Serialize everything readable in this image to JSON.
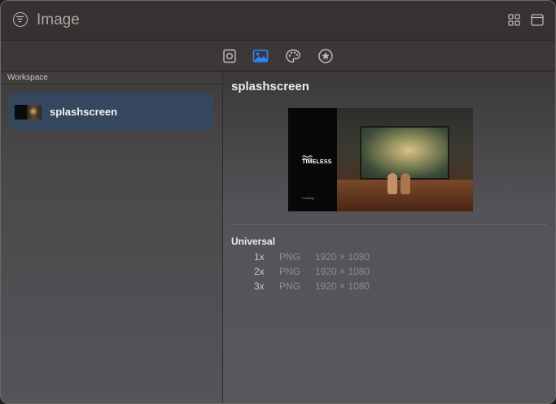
{
  "window": {
    "title": "Image"
  },
  "toolbar": {
    "tabs": [
      {
        "icon": "file-inspector-icon",
        "active": false
      },
      {
        "icon": "image-icon",
        "active": true
      },
      {
        "icon": "palette-icon",
        "active": false
      },
      {
        "icon": "star-icon",
        "active": false
      }
    ],
    "accent": "#2f86ff"
  },
  "sidebar": {
    "header": "Workspace",
    "items": [
      {
        "label": "splashscreen",
        "selected": true
      }
    ]
  },
  "detail": {
    "title": "splashscreen",
    "preview": {
      "logo_text": "TIMELESS",
      "loading_text": "Loading..."
    },
    "section_title": "Universal",
    "variants": [
      {
        "scale": "1x",
        "format": "PNG",
        "dimensions": "1920 × 1080"
      },
      {
        "scale": "2x",
        "format": "PNG",
        "dimensions": "1920 × 1080"
      },
      {
        "scale": "3x",
        "format": "PNG",
        "dimensions": "1920 × 1080"
      }
    ]
  }
}
